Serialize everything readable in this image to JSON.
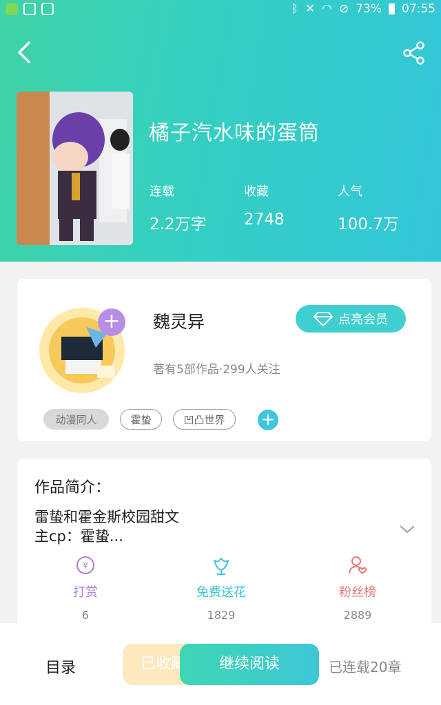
{
  "status_bar": {
    "battery": "73%",
    "time": "07:55"
  },
  "book": {
    "title": "橘子汽水味的蛋筒",
    "stats": [
      {
        "label": "连载",
        "value": "2.2万字"
      },
      {
        "label": "收藏",
        "value": "2748"
      },
      {
        "label": "人气",
        "value": "100.7万"
      }
    ]
  },
  "author": {
    "name": "魏灵异",
    "vip_button": "点亮会员",
    "info": "著有5部作品·299人关注",
    "tags": [
      "动漫同人",
      "霍蛰",
      "凹凸世界"
    ]
  },
  "intro": {
    "heading": "作品简介：",
    "lines": [
      "雷蛰和霍金斯校园甜文",
      "主cp：霍蛰..."
    ]
  },
  "actions": [
    {
      "label": "打赏",
      "count": "6",
      "color": "#b07fd8"
    },
    {
      "label": "免费送花",
      "count": "1829",
      "color": "#3cc6d6"
    },
    {
      "label": "粉丝榜",
      "count": "2889",
      "color": "#e8787a"
    }
  ],
  "bottom": {
    "toc": "目录",
    "favorited": "已收藏",
    "continue": "继续阅读",
    "serial": "已连载20章"
  }
}
